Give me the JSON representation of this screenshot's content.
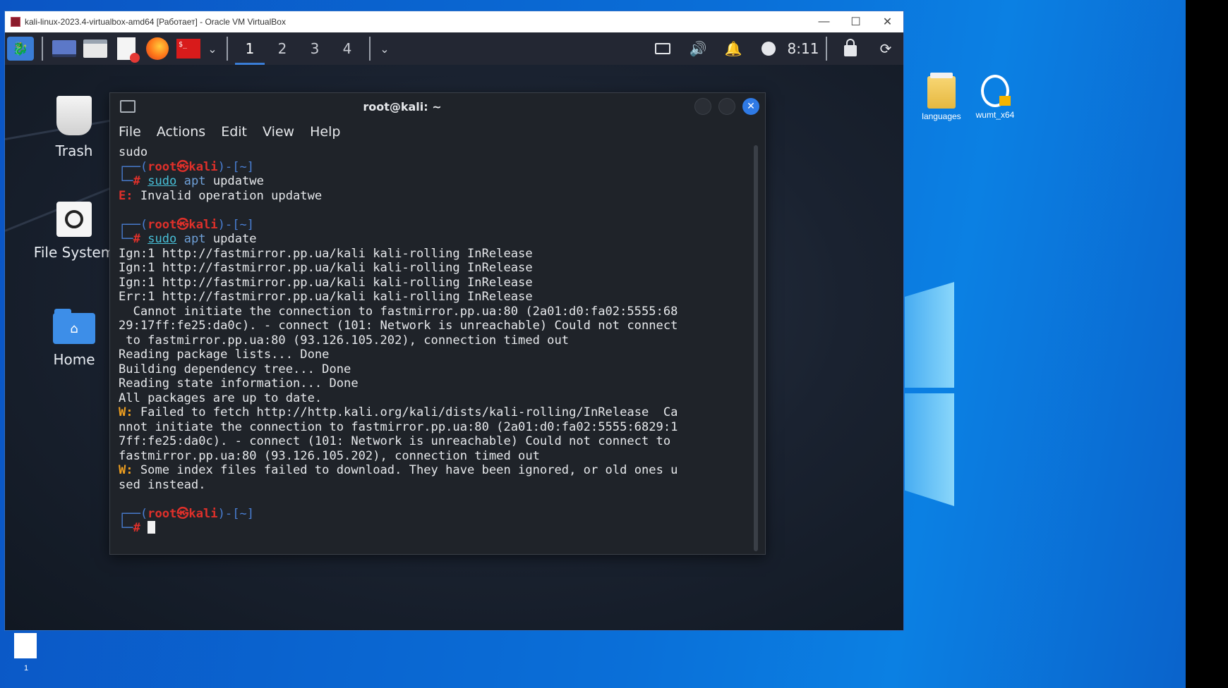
{
  "vbox": {
    "title": "kali-linux-2023.4-virtualbox-amd64 [Работает] - Oracle VM VirtualBox",
    "min": "—",
    "max": "☐",
    "close": "✕"
  },
  "panel": {
    "workspaces": [
      "1",
      "2",
      "3",
      "4"
    ],
    "clock": "8:11"
  },
  "kali_desktop": {
    "trash": "Trash",
    "filesystem": "File System",
    "home": "Home"
  },
  "windows_desktop": {
    "icon1": "languages",
    "icon2": "wumt_x64",
    "taskbar_num": "1"
  },
  "terminal": {
    "title": "root@kali: ~",
    "menu": [
      "File",
      "Actions",
      "Edit",
      "View",
      "Help"
    ],
    "prompt_open": "┌──(",
    "user_host": "root㉿kali",
    "prompt_dir": ")-[~]",
    "prompt_close": "└─",
    "prompt_hash": "#",
    "sudo": "sudo",
    "apt": "apt",
    "lines": {
      "l0": "sudo",
      "cmd1_arg": "updatwe",
      "err_prefix": "E:",
      "err_text": " Invalid operation updatwe",
      "cmd2_arg": "update",
      "ign1": "Ign:1 http://fastmirror.pp.ua/kali kali-rolling InRelease",
      "ign2": "Ign:1 http://fastmirror.pp.ua/kali kali-rolling InRelease",
      "ign3": "Ign:1 http://fastmirror.pp.ua/kali kali-rolling InRelease",
      "err1": "Err:1 http://fastmirror.pp.ua/kali kali-rolling InRelease",
      "cannot1": "  Cannot initiate the connection to fastmirror.pp.ua:80 (2a01:d0:fa02:5555:68",
      "cannot2": "29:17ff:fe25:da0c). - connect (101: Network is unreachable) Could not connect",
      "cannot3": " to fastmirror.pp.ua:80 (93.126.105.202), connection timed out",
      "reading": "Reading package lists... Done",
      "building": "Building dependency tree... Done",
      "state": "Reading state information... Done",
      "uptodate": "All packages are up to date.",
      "warn_prefix": "W:",
      "w1a": " Failed to fetch http://http.kali.org/kali/dists/kali-rolling/InRelease  Ca",
      "w1b": "nnot initiate the connection to fastmirror.pp.ua:80 (2a01:d0:fa02:5555:6829:1",
      "w1c": "7ff:fe25:da0c). - connect (101: Network is unreachable) Could not connect to",
      "w1d": "fastmirror.pp.ua:80 (93.126.105.202), connection timed out",
      "w2a": " Some index files failed to download. They have been ignored, or old ones u",
      "w2b": "sed instead."
    }
  }
}
